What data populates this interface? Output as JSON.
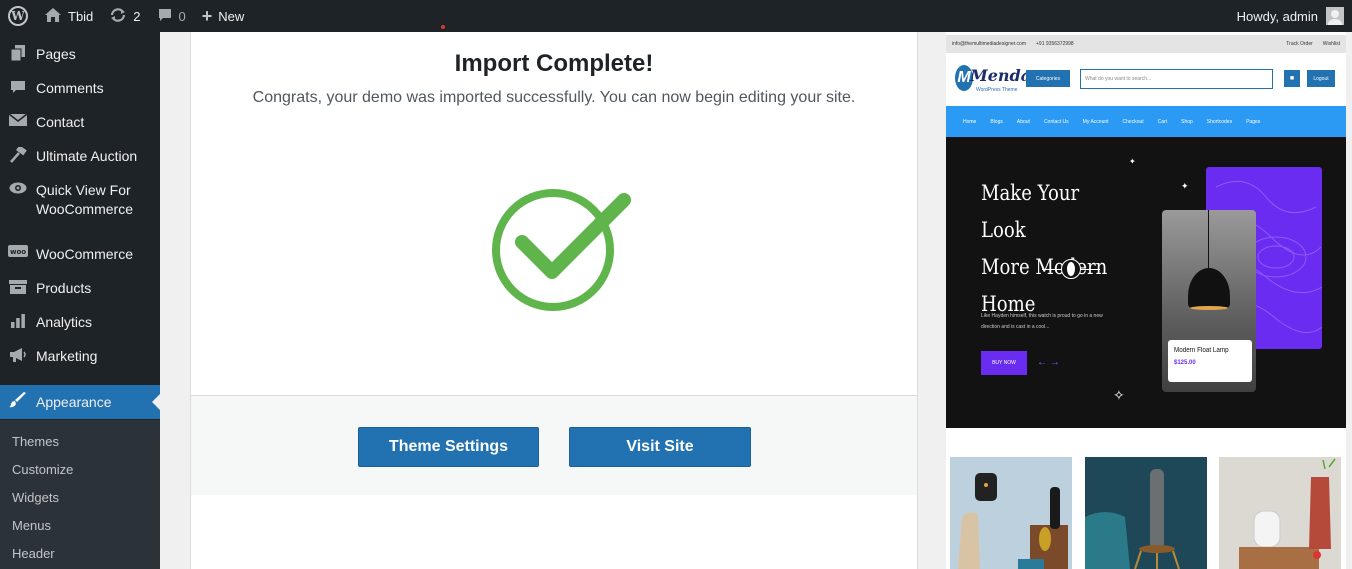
{
  "adminbar": {
    "site_name": "Tbid",
    "updates_count": "2",
    "comments_count": "0",
    "new_label": "New",
    "howdy": "Howdy, admin"
  },
  "sidebar": {
    "items": [
      {
        "label": "Pages",
        "icon": "pages-icon"
      },
      {
        "label": "Comments",
        "icon": "comments-icon"
      },
      {
        "label": "Contact",
        "icon": "mail-icon"
      },
      {
        "label": "Ultimate Auction",
        "icon": "hammer-icon"
      },
      {
        "label": "Quick View For WooCommerce",
        "icon": "eye-icon"
      },
      {
        "label": "WooCommerce",
        "icon": "woo-icon"
      },
      {
        "label": "Products",
        "icon": "archive-icon"
      },
      {
        "label": "Analytics",
        "icon": "bar-chart-icon"
      },
      {
        "label": "Marketing",
        "icon": "megaphone-icon"
      },
      {
        "label": "Appearance",
        "icon": "paintbrush-icon"
      }
    ],
    "submenu": [
      "Themes",
      "Customize",
      "Widgets",
      "Menus",
      "Header"
    ]
  },
  "main": {
    "title": "Import Complete!",
    "subtitle": "Congrats, your demo was imported successfully. You can now begin editing your site.",
    "theme_settings_label": "Theme Settings",
    "visit_site_label": "Visit Site",
    "check_color": "#5fb54b",
    "button_color": "#2271b1"
  },
  "preview": {
    "topbar_email": "info@themultimediadesigner.com",
    "topbar_phone": "+91 9356372998",
    "topbar_track": "Track Order",
    "topbar_wishlist": "Wishlist",
    "logo_text": "Menda",
    "logo_sub": "WordPress Theme",
    "categories_label": "Categories",
    "search_placeholder": "What do you want to search...",
    "logout_label": "Logout",
    "nav": [
      "Home",
      "Blogs",
      "About",
      "Contact Us",
      "My Account",
      "Checkout",
      "Cart",
      "Shop",
      "Shortcodes",
      "Pages"
    ],
    "hero_heading": [
      "Make Your Look",
      "More Modern",
      "Home"
    ],
    "hero_text": "Like Hayden himself, this watch is proud to go in a new direction and is cast in a cool...",
    "buy_now_label": "BUY NOW",
    "product_name": "Modern Float Lamp",
    "product_price": "$125.00",
    "accent_color": "#6a2cf0",
    "nav_color": "#2a9af5"
  }
}
